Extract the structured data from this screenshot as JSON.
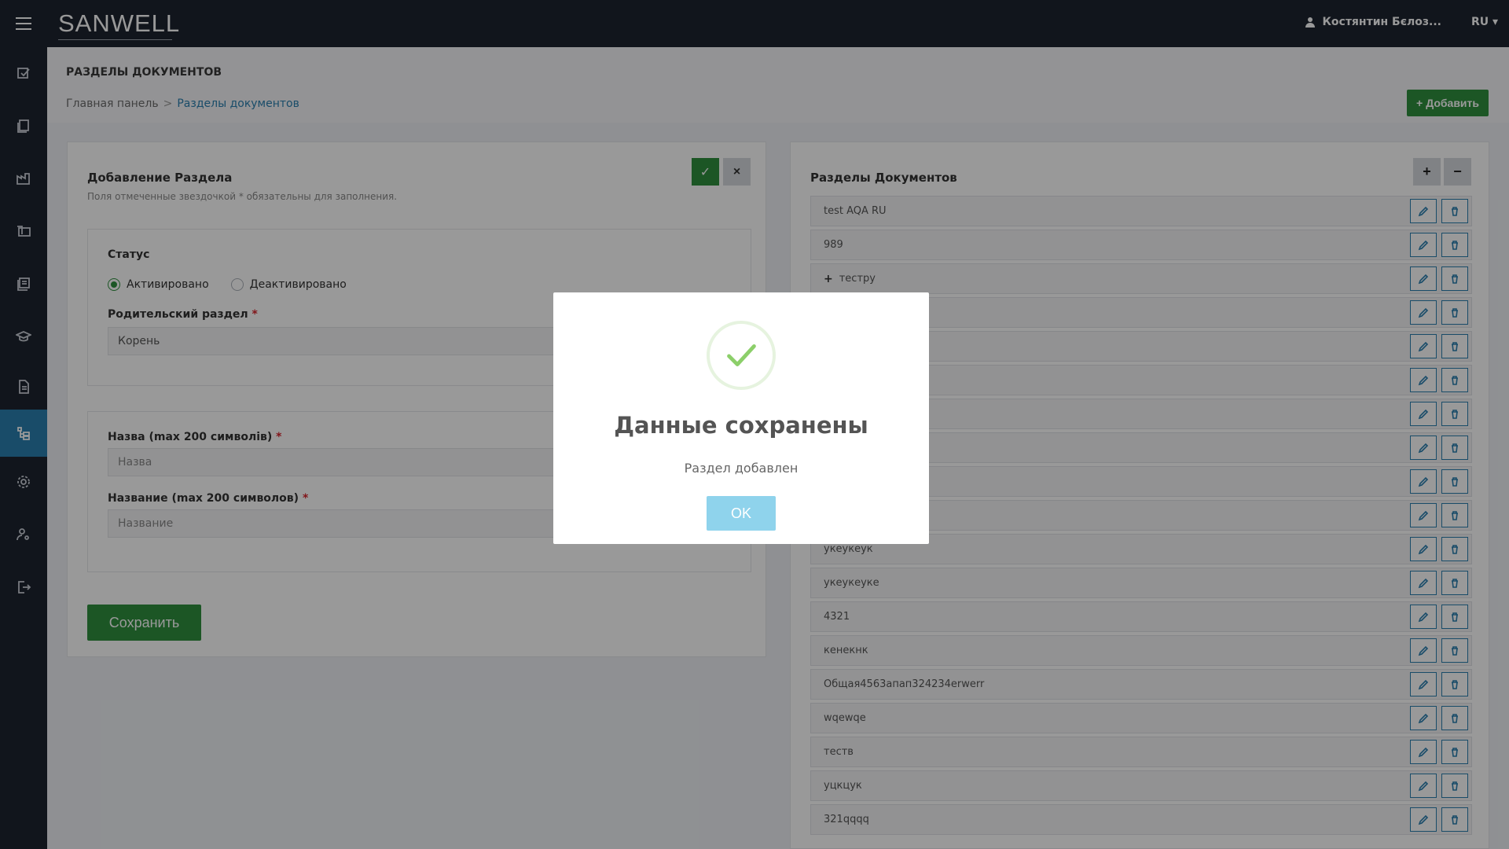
{
  "brand": {
    "logo": "SANWELL"
  },
  "topbar": {
    "user_name": "Костянтин Бєлоз...",
    "language": "RU"
  },
  "sidebar": {
    "items": [
      {
        "icon": "checklist-icon"
      },
      {
        "icon": "books-icon"
      },
      {
        "icon": "factory-icon"
      },
      {
        "icon": "folders-icon"
      },
      {
        "icon": "library-icon"
      },
      {
        "icon": "graduation-icon"
      },
      {
        "icon": "document-icon"
      },
      {
        "icon": "tree-icon",
        "active": true
      },
      {
        "icon": "gear-icon"
      },
      {
        "icon": "user-settings-icon"
      },
      {
        "icon": "logout-icon"
      }
    ]
  },
  "header": {
    "title": "РАЗДЕЛЫ ДОКУМЕНТОВ",
    "breadcrumb": {
      "home": "Главная панель",
      "separator": ">",
      "current": "Разделы документов"
    },
    "add_button": "Добавить"
  },
  "form": {
    "title": "Добавление Раздела",
    "hint": "Поля отмеченные звездочкой * обязательны для заполнения.",
    "status_label": "Статус",
    "status_options": [
      "Активировано",
      "Деактивировано"
    ],
    "parent_label": "Родительский раздел",
    "parent_value": "Корень",
    "name_ua_label": "Назва (max 200 символів)",
    "name_ua_placeholder": "Назва",
    "name_ru_label": "Название (max 200 символов)",
    "name_ru_placeholder": "Название",
    "required_mark": "*",
    "save_button": "Сохранить"
  },
  "sections": {
    "title": "Разделы Документов",
    "items": [
      {
        "label": "test AQA RU"
      },
      {
        "label": "989"
      },
      {
        "label": "тестру",
        "expandable": true
      },
      {
        "label": ""
      },
      {
        "label": ""
      },
      {
        "label": ""
      },
      {
        "label": ""
      },
      {
        "label": ""
      },
      {
        "label": ""
      },
      {
        "label": ""
      },
      {
        "label": "укеукеук"
      },
      {
        "label": "укеукеуке"
      },
      {
        "label": "4321"
      },
      {
        "label": "кенекнк"
      },
      {
        "label": "Общая4563апап324234erwerr"
      },
      {
        "label": "wqewqe"
      },
      {
        "label": "теств"
      },
      {
        "label": "уцкцук"
      },
      {
        "label": "321qqqq"
      }
    ]
  },
  "modal": {
    "title": "Данные сохранены",
    "message": "Раздел добавлен",
    "ok_button": "OK"
  },
  "colors": {
    "dark": "#1d2330",
    "accent_blue": "#2b7fb0",
    "success_green": "#2f8f3f",
    "modal_button": "#8fd3ec"
  }
}
